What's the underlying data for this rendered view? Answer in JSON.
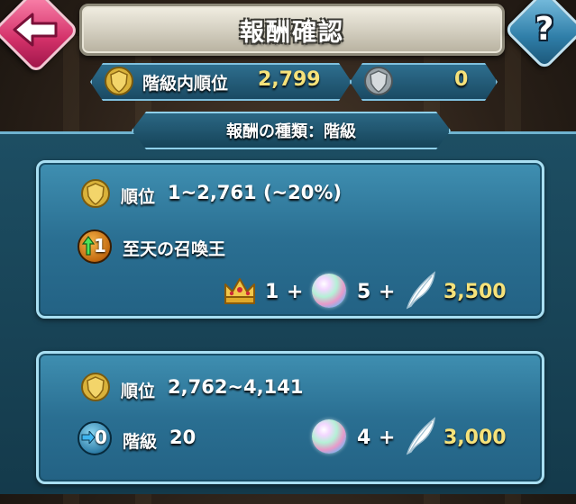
{
  "header": {
    "title": "報酬確認",
    "back_icon": "back-arrow-icon",
    "help_label": "?"
  },
  "rank_bar": {
    "label": "階級内順位",
    "value": "2,799",
    "icon": "gold-shield-icon"
  },
  "points_bar": {
    "value": "0",
    "icon": "silver-shield-icon"
  },
  "reward_type_tab": {
    "label": "報酬の種類：階級"
  },
  "cards": [
    {
      "rank_label": "順位",
      "rank_range": "1~2,761 (~20%)",
      "bonus_badge": "1",
      "bonus_text": "至天の召喚王",
      "rewards": [
        {
          "icon": "crown-icon",
          "amount": "1",
          "sep": "+"
        },
        {
          "icon": "orb-icon",
          "amount": "5",
          "sep": "+"
        },
        {
          "icon": "feather-icon",
          "amount": "3,500"
        }
      ]
    },
    {
      "rank_label": "順位",
      "rank_range": "2,762~4,141",
      "badge": "0",
      "tier_label": "階級",
      "tier_value": "20",
      "rewards": [
        {
          "icon": "orb-icon",
          "amount": "4",
          "sep": "+"
        },
        {
          "icon": "feather-icon",
          "amount": "3,000"
        }
      ]
    }
  ],
  "colors": {
    "gold_text": "#f6e27a",
    "panel_teal": "#2a6f92",
    "back_button": "#d4326a",
    "help_button": "#2f7ea8"
  }
}
